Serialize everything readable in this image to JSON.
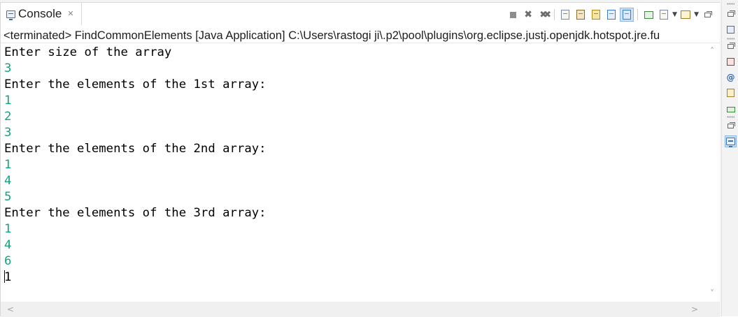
{
  "console_tab": {
    "icon": "console-icon",
    "label": "Console",
    "close_symbol": "✕"
  },
  "toolbar": {
    "buttons": [
      {
        "name": "terminate-icon"
      },
      {
        "name": "remove-launch-icon"
      },
      {
        "name": "remove-all-terminated-icon"
      },
      {
        "name": "scroll-lock-icon"
      },
      {
        "name": "word-wrap-icon"
      },
      {
        "name": "show-on-stdout-icon"
      },
      {
        "name": "show-on-stderr-icon"
      },
      {
        "name": "pin-console-icon"
      },
      {
        "name": "display-selected-console-icon"
      },
      {
        "name": "open-console-icon"
      },
      {
        "name": "minimize-icon"
      }
    ]
  },
  "process_line": "<terminated> FindCommonElements [Java Application] C:\\Users\\rastogi ji\\.p2\\pool\\plugins\\org.eclipse.justj.openjdk.hotspot.jre.fu",
  "output": {
    "lines": [
      {
        "text": "Enter size of the array",
        "kind": "stdout"
      },
      {
        "text": "3",
        "kind": "stdin"
      },
      {
        "text": "Enter the elements of the 1st array:",
        "kind": "stdout"
      },
      {
        "text": "1",
        "kind": "stdin"
      },
      {
        "text": "2",
        "kind": "stdin"
      },
      {
        "text": "3",
        "kind": "stdin"
      },
      {
        "text": "Enter the elements of the 2nd array:",
        "kind": "stdout"
      },
      {
        "text": "1",
        "kind": "stdin"
      },
      {
        "text": "4",
        "kind": "stdin"
      },
      {
        "text": "5",
        "kind": "stdin"
      },
      {
        "text": "Enter the elements of the 3rd array:",
        "kind": "stdout"
      },
      {
        "text": "1",
        "kind": "stdin"
      },
      {
        "text": "4",
        "kind": "stdin"
      },
      {
        "text": "6",
        "kind": "stdin"
      },
      {
        "text": "1",
        "kind": "cursor"
      }
    ]
  },
  "colors": {
    "stdout": "#000000",
    "stdin": "#14a37f",
    "pressed_button": "#cfe3f8"
  },
  "scrollbars": {
    "up_arrow": "˄",
    "down_arrow": "˅",
    "left_arrow": "<",
    "right_arrow": ">"
  },
  "trim": {
    "buttons": [
      {
        "name": "restore-icon"
      },
      {
        "name": "outline-icon"
      },
      {
        "name": "restore-icon"
      },
      {
        "name": "problems-icon"
      },
      {
        "name": "javadoc-icon"
      },
      {
        "name": "declaration-icon"
      },
      {
        "name": "servers-icon"
      },
      {
        "name": "restore-icon"
      },
      {
        "name": "console-icon"
      }
    ]
  }
}
